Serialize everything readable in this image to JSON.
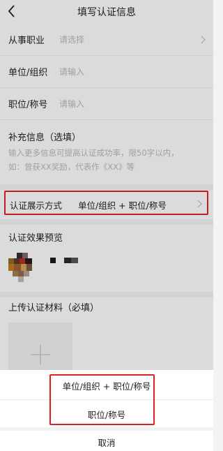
{
  "nav": {
    "title": "填写认证信息",
    "back_icon": "chevron-left-icon"
  },
  "form": {
    "occupation": {
      "label": "从事职业",
      "placeholder": "请选择"
    },
    "organization": {
      "label": "单位/组织",
      "placeholder": "请输入"
    },
    "position": {
      "label": "职位/称号",
      "placeholder": "请输入"
    },
    "supplement": {
      "label": "补充信息（选填）",
      "hint_line1": "输入更多信息可提高认证成功率，限50字以内，",
      "hint_line2": "如：曾获XX奖励，代表作《XX》等"
    },
    "display_method": {
      "label": "认证展示方式",
      "value": "单位/组织 + 职位/称号"
    }
  },
  "preview": {
    "title": "认证效果预览"
  },
  "upload": {
    "title": "上传认证材料（必填）",
    "add_icon": "plus-icon"
  },
  "action_sheet": {
    "options": [
      "单位/组织 + 职位/称号",
      "职位/称号"
    ],
    "cancel": "取消"
  },
  "colors": {
    "highlight": "#e02020",
    "placeholder": "#b6b6b6"
  }
}
